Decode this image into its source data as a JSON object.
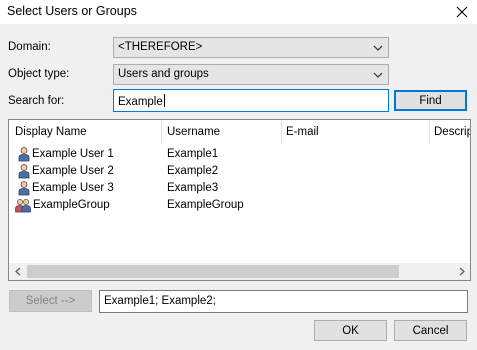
{
  "window": {
    "title": "Select Users or Groups"
  },
  "form": {
    "domain_label": "Domain:",
    "domain_value": "<THEREFORE>",
    "object_type_label": "Object type:",
    "object_type_value": "Users and groups",
    "search_label": "Search for:",
    "search_value": "Example",
    "find_label": "Find"
  },
  "list": {
    "columns": [
      "Display Name",
      "Username",
      "E-mail",
      "Descrip"
    ],
    "rows": [
      {
        "icon": "user-icon",
        "display": "Example User 1",
        "username": "Example1",
        "email": ""
      },
      {
        "icon": "user-icon",
        "display": "Example User 2",
        "username": "Example2",
        "email": ""
      },
      {
        "icon": "user-icon",
        "display": "Example User 3",
        "username": "Example3",
        "email": ""
      },
      {
        "icon": "group-icon",
        "display": "ExampleGroup",
        "username": "ExampleGroup",
        "email": ""
      }
    ]
  },
  "selection": {
    "select_button": "Select -->",
    "selected_value": "Example1; Example2;"
  },
  "footer": {
    "ok": "OK",
    "cancel": "Cancel"
  },
  "colors": {
    "accent": "#0078d7",
    "background": "#f0f0f0"
  }
}
